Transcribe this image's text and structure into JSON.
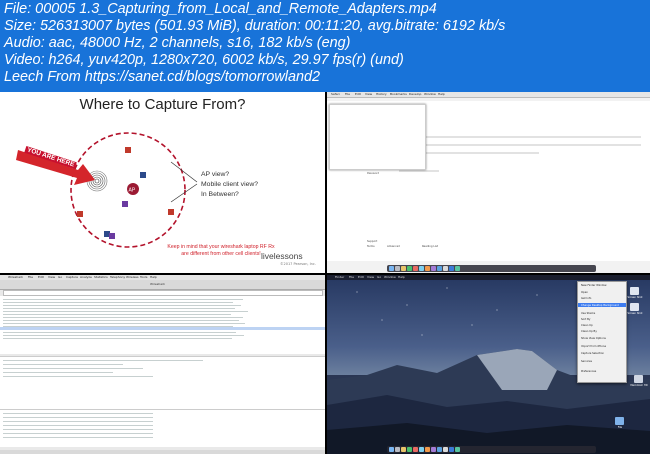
{
  "header": {
    "lines": [
      "File: 00005 1.3_Capturing_from_Local_and_Remote_Adapters.mp4",
      "Size: 526313007 bytes (501.93 MiB), duration: 00:11:20, avg.bitrate: 6192 kb/s",
      "Audio: aac, 48000 Hz, 2 channels, s16, 182 kb/s (eng)",
      "Video: h264, yuv420p, 1280x720, 6002 kb/s, 29.97 fps(r) (und)",
      "Leech From https://sanet.cd/blogs/tomorrowland2"
    ],
    "background": "#1873d9"
  },
  "thumb1": {
    "title": "Where to Capture From?",
    "badge": "YOU ARE HERE",
    "ap_label": "AP",
    "options": [
      "AP view?",
      "Mobile client view?",
      "In Between?"
    ],
    "note_lines": [
      "Keep in mind that your wireshark laptop RF Rx",
      "are different from other cell clients!"
    ],
    "brand": "livelessons",
    "brand_copyright": "©2017 Pearson, Inc.",
    "colors": {
      "circle": "#b3122b",
      "arrow": "#d4252b",
      "badge": "#c8102e"
    }
  },
  "thumb2": {
    "menu_items": [
      "Safari",
      "File",
      "Edit",
      "View",
      "History",
      "Bookmarks",
      "Develop",
      "Window",
      "Help"
    ],
    "labels": [
      "Passphrase",
      "Hidden",
      "Name",
      "Password"
    ],
    "footer_labels": [
      "Support",
      "Terms",
      "Advanced",
      "Reading List"
    ]
  },
  "thumb3": {
    "app_name": "Wireshark",
    "menu_items": [
      "Wireshark",
      "File",
      "Edit",
      "View",
      "Go",
      "Capture",
      "Analyze",
      "Statistics",
      "Telephony",
      "Wireless",
      "Tools",
      "Help"
    ]
  },
  "thumb4": {
    "menu_items": [
      "Finder",
      "File",
      "Edit",
      "View",
      "Go",
      "Window",
      "Help"
    ],
    "menu_entries": [
      "New Finder Window",
      "Open",
      "Get Info",
      "Change Desktop Background",
      "Use Stacks",
      "Sort By",
      "Clean Up",
      "Clean Up By",
      "Show View Options",
      "Import from iPhone",
      "Capture Selection",
      "Services",
      "Preferences"
    ],
    "desktop_items": [
      "Screen Shot",
      "Screen Shot",
      "Macintosh HD",
      "File"
    ]
  }
}
